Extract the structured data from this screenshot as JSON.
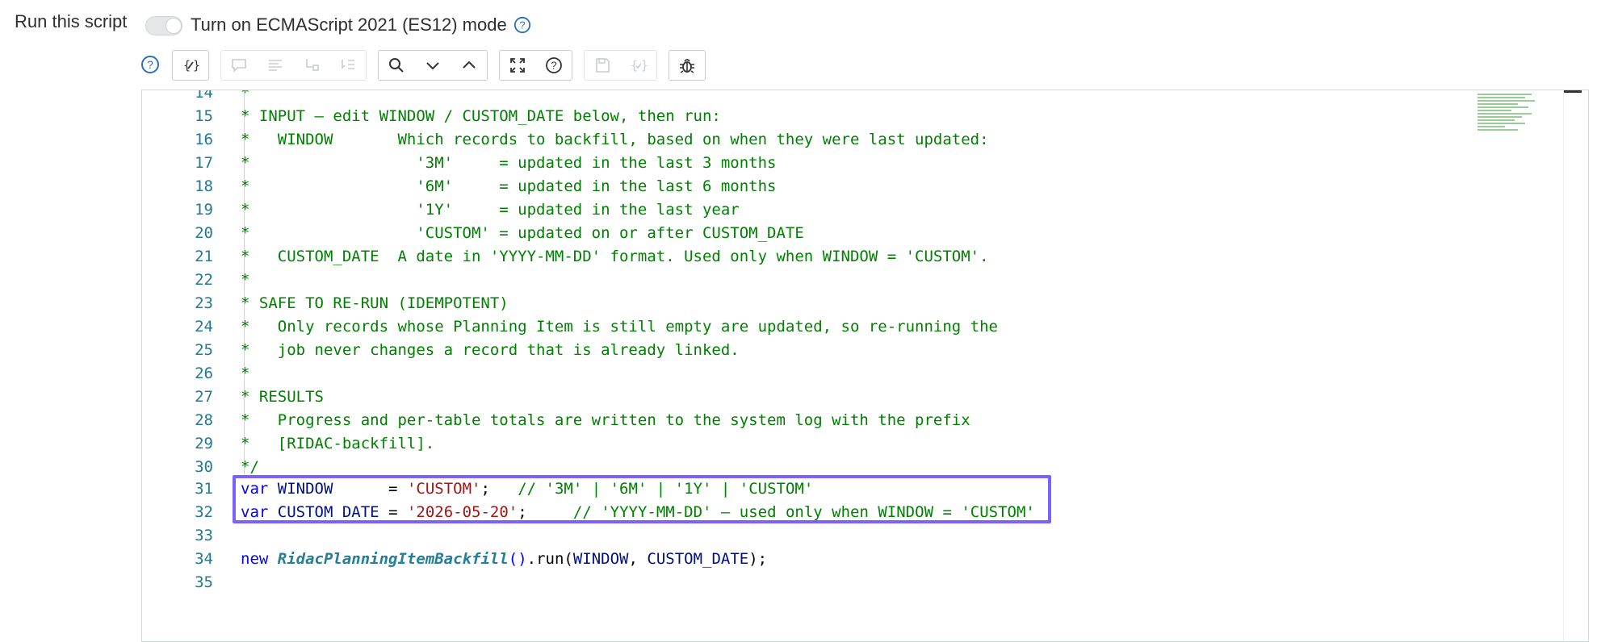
{
  "header": {
    "run_label": "Run this script",
    "es_mode_label": "Turn on ECMAScript 2021 (ES12) mode",
    "es_mode_enabled": false
  },
  "toolbar": {
    "buttons": [
      {
        "icon": "format-code-icon",
        "enabled": true
      },
      {
        "icon": "comment-icon",
        "enabled": false
      },
      {
        "icon": "align-left-icon",
        "enabled": false
      },
      {
        "icon": "script-include-icon",
        "enabled": false
      },
      {
        "icon": "list-check-icon",
        "enabled": false
      },
      {
        "icon": "search-icon",
        "enabled": true
      },
      {
        "icon": "chevron-down-icon",
        "enabled": true
      },
      {
        "icon": "chevron-up-icon",
        "enabled": true
      },
      {
        "icon": "fullscreen-icon",
        "enabled": true
      },
      {
        "icon": "help-icon",
        "enabled": true
      },
      {
        "icon": "save-icon",
        "enabled": false
      },
      {
        "icon": "script-braces-icon",
        "enabled": false
      },
      {
        "icon": "debug-bug-icon",
        "enabled": true
      }
    ]
  },
  "editor": {
    "partial_line_number": "14",
    "partial_line_text": "*",
    "lines": [
      {
        "n": "15",
        "comment": "* INPUT — edit WINDOW / CUSTOM_DATE below, then run:"
      },
      {
        "n": "16",
        "comment": "*   WINDOW       Which records to backfill, based on when they were last updated:"
      },
      {
        "n": "17",
        "comment": "*                  '3M'     = updated in the last 3 months"
      },
      {
        "n": "18",
        "comment": "*                  '6M'     = updated in the last 6 months"
      },
      {
        "n": "19",
        "comment": "*                  '1Y'     = updated in the last year"
      },
      {
        "n": "20",
        "comment": "*                  'CUSTOM' = updated on or after CUSTOM_DATE"
      },
      {
        "n": "21",
        "comment": "*   CUSTOM_DATE  A date in 'YYYY-MM-DD' format. Used only when WINDOW = 'CUSTOM'."
      },
      {
        "n": "22",
        "comment": "*"
      },
      {
        "n": "23",
        "comment": "* SAFE TO RE-RUN (IDEMPOTENT)"
      },
      {
        "n": "24",
        "comment": "*   Only records whose Planning Item is still empty are updated, so re-running the"
      },
      {
        "n": "25",
        "comment": "*   job never changes a record that is already linked."
      },
      {
        "n": "26",
        "comment": "*"
      },
      {
        "n": "27",
        "comment": "* RESULTS"
      },
      {
        "n": "28",
        "comment": "*   Progress and per-table totals are written to the system log with the prefix"
      },
      {
        "n": "29",
        "comment": "*   [RIDAC-backfill]."
      },
      {
        "n": "30",
        "comment": "*/"
      }
    ],
    "line31": {
      "n": "31",
      "kw": "var",
      "name": "WINDOW",
      "assign": "      = ",
      "value": "'CUSTOM'",
      "semi": ";",
      "comment": "   // '3M' | '6M' | '1Y' | 'CUSTOM'"
    },
    "line32": {
      "n": "32",
      "kw": "var",
      "name": "CUSTOM_DATE",
      "assign": " = ",
      "value": "'2026-05-20'",
      "semi": ";",
      "comment": "     // 'YYYY-MM-DD' — used only when WINDOW = 'CUSTOM'"
    },
    "line33": {
      "n": "33"
    },
    "line34": {
      "n": "34",
      "kw": "new",
      "cls": "RidacPlanningItemBackfill",
      "parens": "()",
      "dot_run": ".run(",
      "arg1": "WINDOW",
      "comma": ", ",
      "arg2": "CUSTOM_DATE",
      "close": ");"
    },
    "line35": {
      "n": "35"
    }
  },
  "colors": {
    "highlight": "#7b61ff",
    "comment": "#008000",
    "keyword": "#0000ff",
    "string": "#a31515",
    "line_number": "#237893"
  }
}
